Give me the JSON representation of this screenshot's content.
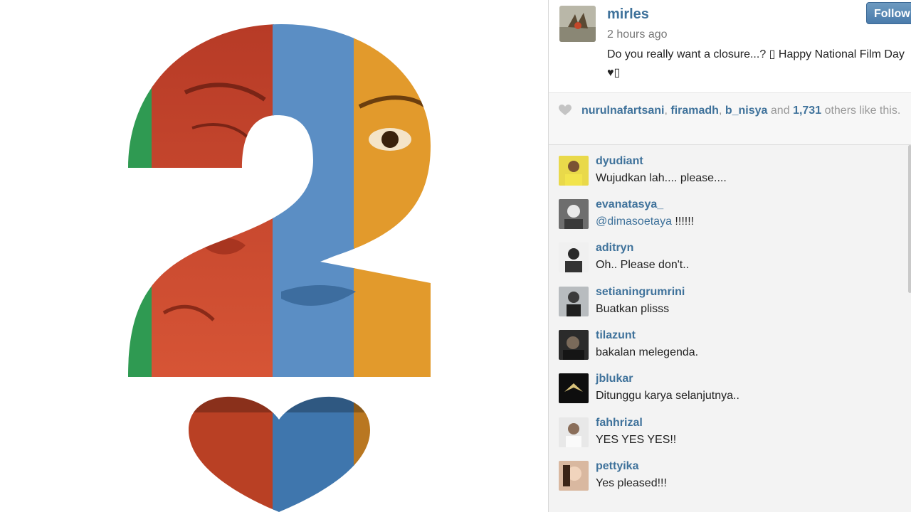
{
  "post": {
    "username": "mirles",
    "time_ago": "2 hours ago",
    "caption": "Do you really want a closure...? ▯ Happy National Film Day ♥▯",
    "follow_label": "Follow"
  },
  "likes": {
    "user1": "nurulnafartsani",
    "sep1": ",",
    "user2": "firamadh",
    "sep2": ",",
    "user3": "b_nisya",
    "and_text": "and",
    "count": "1,731",
    "suffix": "others like this."
  },
  "comments": [
    {
      "user": "dyudiant",
      "text": "Wujudkan lah.... please...."
    },
    {
      "user": "evanatasya_",
      "mention": "@dimasoetaya",
      "text": "!!!!!!"
    },
    {
      "user": "aditryn",
      "text": "Oh.. Please don't.."
    },
    {
      "user": "setianingrumrini",
      "text": "Buatkan plisss"
    },
    {
      "user": "tilazunt",
      "text": "bakalan melegenda."
    },
    {
      "user": "jblukar",
      "text": "Ditunggu karya selanjutnya.."
    },
    {
      "user": "fahhrizal",
      "text": "YES YES YES!!"
    },
    {
      "user": "pettyika",
      "text": "Yes pleased!!!"
    }
  ],
  "colors": {
    "accent": "#3f729b",
    "poster_green": "#2f9a52",
    "poster_red": "#c94a2e",
    "poster_blue": "#5b8ec4",
    "poster_orange": "#e29a2c"
  }
}
